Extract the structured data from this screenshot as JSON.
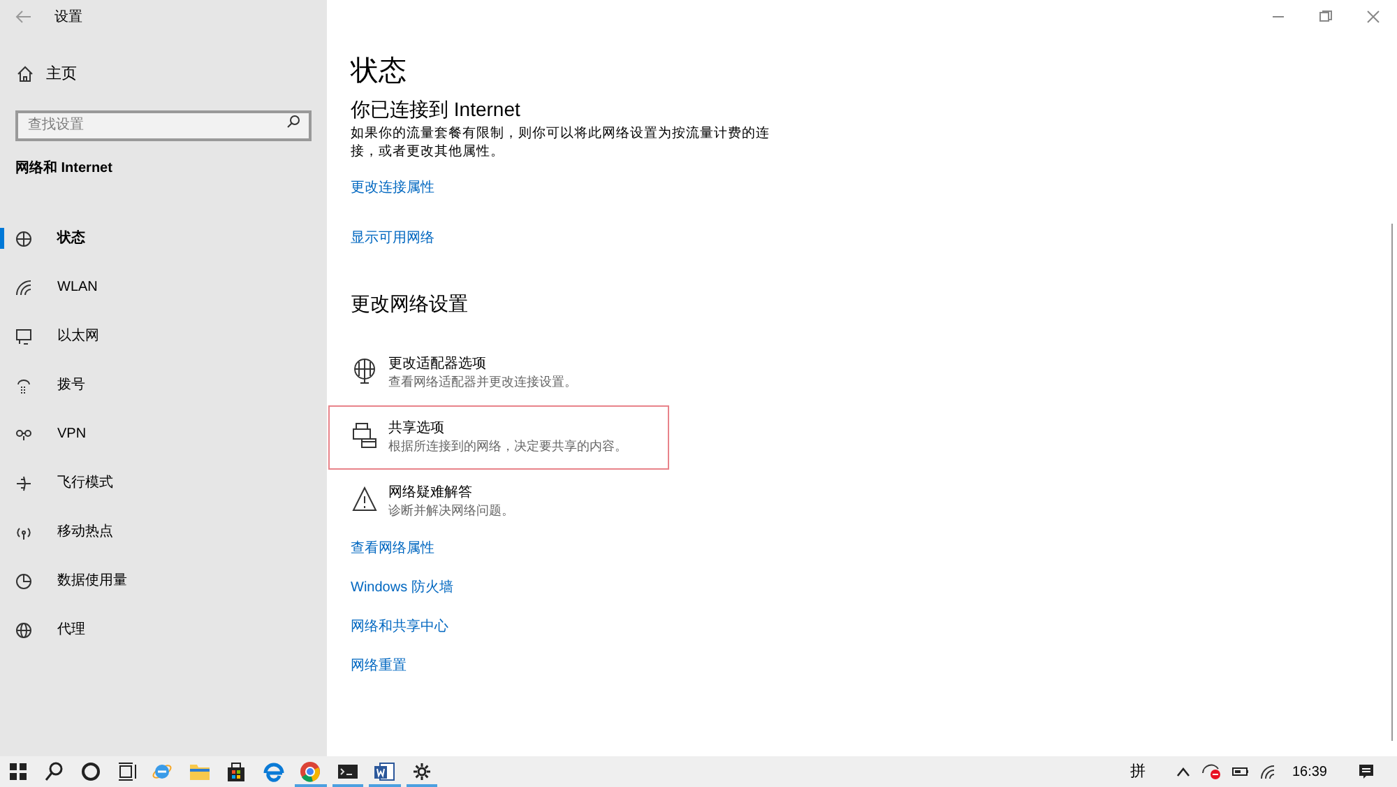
{
  "window": {
    "title": "设置"
  },
  "sidebar": {
    "home": "主页",
    "search": {
      "placeholder": "查找设置"
    },
    "section": "网络和 Internet",
    "items": [
      {
        "label": "状态",
        "selected": true
      },
      {
        "label": "WLAN",
        "selected": false
      },
      {
        "label": "以太网",
        "selected": false
      },
      {
        "label": "拨号",
        "selected": false
      },
      {
        "label": "VPN",
        "selected": false
      },
      {
        "label": "飞行模式",
        "selected": false
      },
      {
        "label": "移动热点",
        "selected": false
      },
      {
        "label": "数据使用量",
        "selected": false
      },
      {
        "label": "代理",
        "selected": false
      }
    ]
  },
  "main": {
    "title": "状态",
    "heading": "你已连接到 Internet",
    "description": "如果你的流量套餐有限制，则你可以将此网络设置为按流量计费的连接，或者更改其他属性。",
    "links": [
      "更改连接属性",
      "显示可用网络"
    ],
    "section": "更改网络设置",
    "options": [
      {
        "title": "更改适配器选项",
        "description": "查看网络适配器并更改连接设置。",
        "highlighted": false
      },
      {
        "title": "共享选项",
        "description": "根据所连接到的网络，决定要共享的内容。",
        "highlighted": true
      },
      {
        "title": "网络疑难解答",
        "description": "诊断并解决网络问题。",
        "highlighted": false
      }
    ],
    "more_links": [
      "查看网络属性",
      "Windows 防火墙",
      "网络和共享中心",
      "网络重置"
    ]
  },
  "taskbar": {
    "apps": [
      {
        "running": false
      },
      {
        "running": false
      },
      {
        "running": false
      },
      {
        "running": false
      },
      {
        "running": false
      },
      {
        "running": false
      },
      {
        "running": true
      },
      {
        "running": true
      },
      {
        "running": true
      },
      {
        "running": true
      }
    ],
    "ime": "拼",
    "time": "16:39"
  }
}
